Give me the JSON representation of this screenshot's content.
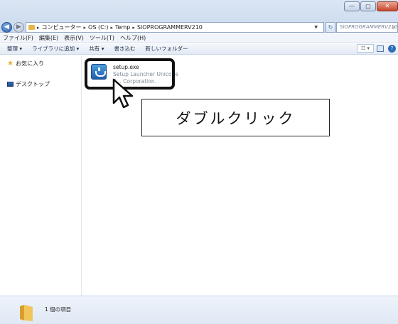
{
  "window": {
    "controls": [
      "—",
      "□",
      "✕"
    ]
  },
  "address_bar": {
    "crumbs": [
      "コンピューター",
      "OS (C:)",
      "Temp",
      "SIOPROGRAMMERV210"
    ]
  },
  "search": {
    "placeholder": "SIOPROGRAMMERV210..."
  },
  "menu": {
    "items": [
      "ファイル(F)",
      "編集(E)",
      "表示(V)",
      "ツール(T)",
      "ヘルプ(H)"
    ]
  },
  "toolbar": {
    "items": [
      "整理 ▾",
      "ライブラリに追加 ▾",
      "共有 ▾",
      "書き込む",
      "新しいフォルダー"
    ]
  },
  "nav_pane": {
    "favorites_label": "お気に入り",
    "desktop_label": "デスクトップ"
  },
  "file": {
    "name": "setup.exe",
    "description": "Setup Launcher Unicode",
    "company": "S... Corporation."
  },
  "annotation": {
    "callout_text": "ダブルクリック"
  },
  "status": {
    "item_count": "1 個の項目"
  },
  "icons": [
    "back-icon",
    "forward-icon",
    "folder-icon",
    "refresh-icon",
    "search-icon",
    "star-icon",
    "desktop-icon",
    "setup-icon",
    "cursor-icon",
    "help-icon"
  ]
}
